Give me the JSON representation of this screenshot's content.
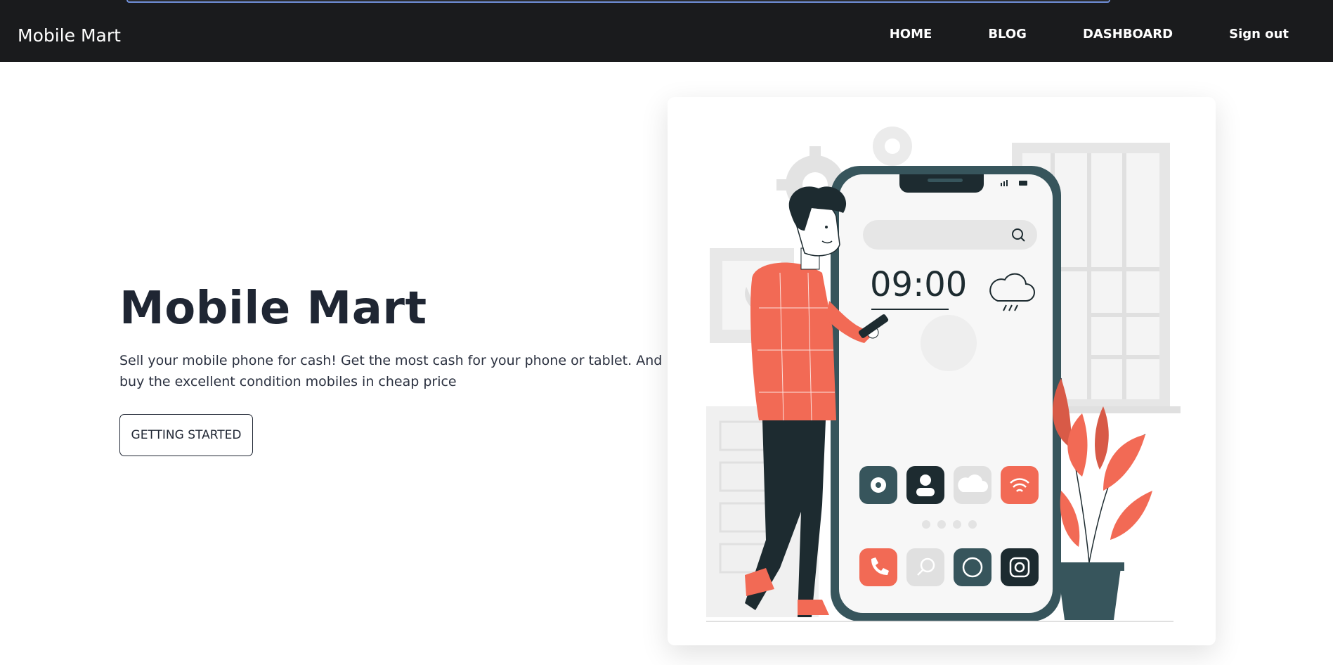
{
  "navbar": {
    "brand": "Mobile Mart",
    "links": [
      "HOME",
      "BLOG",
      "DASHBOARD",
      "Sign out"
    ]
  },
  "hero": {
    "title": "Mobile Mart",
    "description": "Sell your mobile phone for cash! Get the most cash for your phone or tablet. And buy the excellent condition mobiles in cheap price",
    "cta_label": "GETTING STARTED"
  },
  "illustration": {
    "phone_time": "09:00",
    "accent_color": "#f26a55",
    "dark_color": "#1d2b30",
    "teal_color": "#37555c",
    "app_icons_row1": [
      "gear-icon",
      "contact-icon",
      "cloud-icon",
      "wifi-icon"
    ],
    "app_icons_row2": [
      "phone-icon",
      "search-icon",
      "whatsapp-icon",
      "instagram-icon"
    ]
  }
}
